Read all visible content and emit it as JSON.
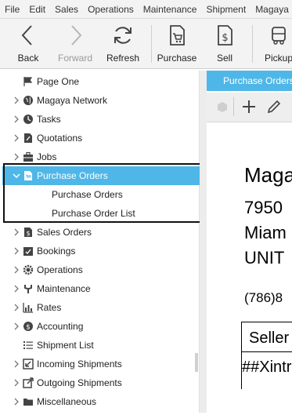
{
  "menu": [
    "File",
    "Edit",
    "Sales",
    "Operations",
    "Maintenance",
    "Shipment",
    "Magaya"
  ],
  "toolbar": {
    "back": "Back",
    "forward": "Forward",
    "refresh": "Refresh",
    "purchase": "Purchase",
    "sell": "Sell",
    "pickup": "Pickup"
  },
  "tree": {
    "items": [
      {
        "label": "Page One",
        "icon": "flag-icon",
        "expandable": false
      },
      {
        "label": "Magaya Network",
        "icon": "globe-icon",
        "expandable": true
      },
      {
        "label": "Tasks",
        "icon": "clock-icon",
        "expandable": true
      },
      {
        "label": "Quotations",
        "icon": "pencil-doc-icon",
        "expandable": true
      },
      {
        "label": "Jobs",
        "icon": "briefcase-icon",
        "expandable": true
      },
      {
        "label": "Purchase Orders",
        "icon": "purchase-order-icon",
        "expandable": true,
        "expanded": true,
        "selected": true
      },
      {
        "label": "Purchase Orders",
        "child": true
      },
      {
        "label": "Purchase Order List",
        "child": true
      },
      {
        "label": "Sales Orders",
        "icon": "dollar-doc-icon",
        "expandable": true
      },
      {
        "label": "Bookings",
        "icon": "calendar-check-icon",
        "expandable": true
      },
      {
        "label": "Operations",
        "icon": "gear-icon",
        "expandable": true
      },
      {
        "label": "Maintenance",
        "icon": "wrench-icon",
        "expandable": true
      },
      {
        "label": "Rates",
        "icon": "bar-chart-icon",
        "expandable": true
      },
      {
        "label": "Accounting",
        "icon": "dollar-circle-icon",
        "expandable": true
      },
      {
        "label": "Shipment List",
        "icon": "list-icon",
        "expandable": false
      },
      {
        "label": "Incoming Shipments",
        "icon": "incoming-icon",
        "expandable": true
      },
      {
        "label": "Outgoing Shipments",
        "icon": "outgoing-icon",
        "expandable": true
      },
      {
        "label": "Miscellaneous",
        "icon": "folder-icon",
        "expandable": true
      }
    ]
  },
  "document": {
    "tab": "Purchase Orders",
    "lines": [
      "Maga",
      "7950",
      "Miam",
      "UNIT",
      "(786)8",
      "Seller",
      "##Xintr"
    ]
  },
  "colors": {
    "accent": "#4fb7e8",
    "highlight_box": "#111111"
  }
}
